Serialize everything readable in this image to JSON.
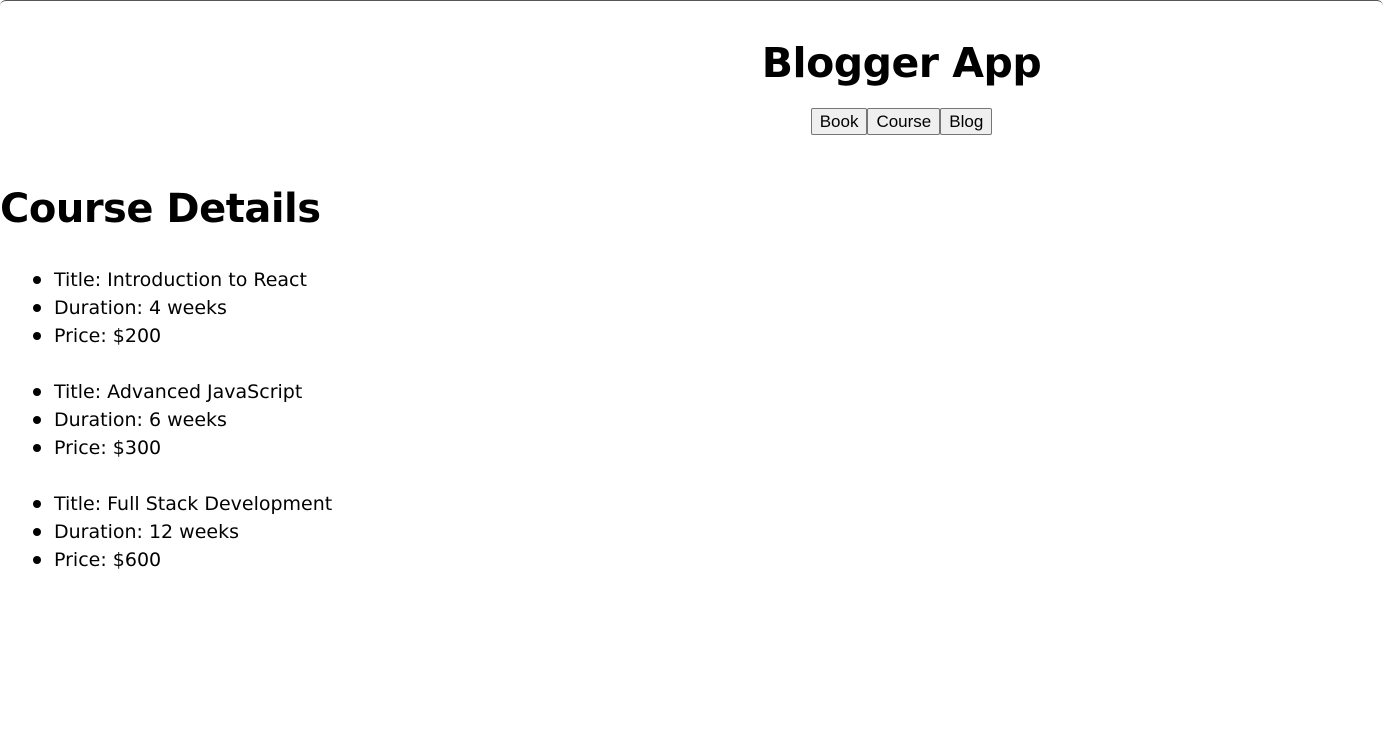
{
  "header": {
    "title": "Blogger App",
    "nav": [
      "Book",
      "Course",
      "Blog"
    ]
  },
  "main": {
    "heading": "Course Details",
    "courses": [
      {
        "title": "Title: Introduction to React",
        "duration": "Duration: 4 weeks",
        "price": "Price: $200"
      },
      {
        "title": "Title: Advanced JavaScript",
        "duration": "Duration: 6 weeks",
        "price": "Price: $300"
      },
      {
        "title": "Title: Full Stack Development",
        "duration": "Duration: 12 weeks",
        "price": "Price: $600"
      }
    ]
  }
}
